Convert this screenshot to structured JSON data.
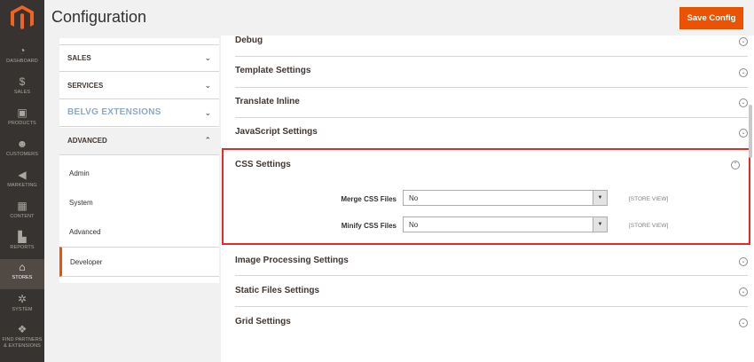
{
  "page": {
    "title": "Configuration"
  },
  "header": {
    "save_label": "Save Config"
  },
  "colors": {
    "accent": "#eb5202",
    "nav_bg": "#373330",
    "highlight_border": "#e02b27"
  },
  "admin_nav": [
    {
      "label": "DASHBOARD",
      "icon": "dashboard-icon",
      "glyph": "◔"
    },
    {
      "label": "SALES",
      "icon": "dollar-icon",
      "glyph": "$"
    },
    {
      "label": "PRODUCTS",
      "icon": "cube-icon",
      "glyph": "▣"
    },
    {
      "label": "CUSTOMERS",
      "icon": "person-icon",
      "glyph": "☻"
    },
    {
      "label": "MARKETING",
      "icon": "megaphone-icon",
      "glyph": "◀"
    },
    {
      "label": "CONTENT",
      "icon": "content-icon",
      "glyph": "▦"
    },
    {
      "label": "REPORTS",
      "icon": "bar-chart-icon",
      "glyph": "▙"
    },
    {
      "label": "STORES",
      "icon": "store-icon",
      "glyph": "⌂"
    },
    {
      "label": "SYSTEM",
      "icon": "gear-icon",
      "glyph": "✲"
    },
    {
      "label": "FIND PARTNERS & EXTENSIONS",
      "icon": "puzzle-icon",
      "glyph": "❖"
    }
  ],
  "sidebar": {
    "groups": [
      {
        "label": "SALES"
      },
      {
        "label": "SERVICES"
      },
      {
        "label": "BELVG EXTENSIONS"
      },
      {
        "label": "ADVANCED"
      }
    ],
    "advanced_items": [
      "Admin",
      "System",
      "Advanced",
      "Developer"
    ]
  },
  "sections": {
    "debug": "Debug",
    "template": "Template Settings",
    "translate": "Translate Inline",
    "javascript": "JavaScript Settings",
    "css": "CSS Settings",
    "image": "Image Processing Settings",
    "static": "Static Files Settings",
    "grid": "Grid Settings"
  },
  "css_settings": {
    "merge": {
      "label": "Merge CSS Files",
      "value": "No",
      "scope": "[STORE VIEW]"
    },
    "minify": {
      "label": "Minify CSS Files",
      "value": "No",
      "scope": "[STORE VIEW]"
    }
  }
}
